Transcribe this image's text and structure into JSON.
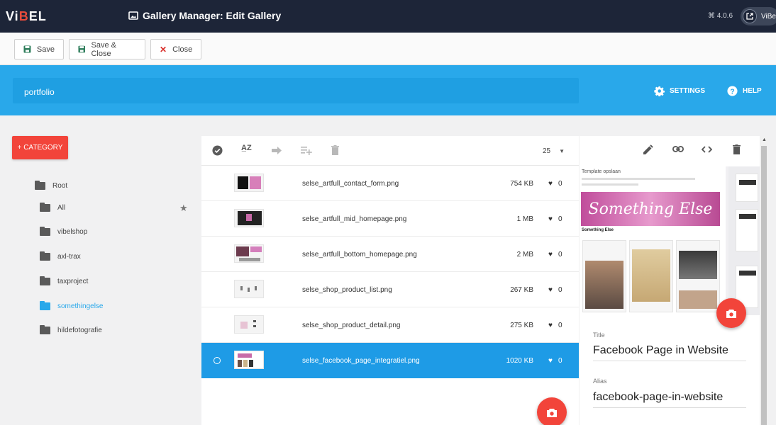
{
  "header": {
    "logo": {
      "part1": "Vi",
      "part2": "B",
      "part3": "EL"
    },
    "title": "Gallery Manager: Edit Gallery",
    "version": "⌘ 4.0.6",
    "user": "ViBel"
  },
  "toolbar": {
    "save_label": "Save",
    "save_close_label": "Save & Close",
    "close_label": "Close"
  },
  "gallery": {
    "name_value": "portfolio",
    "settings_label": "SETTINGS",
    "help_label": "HELP"
  },
  "sidebar": {
    "add_category_label": "+ CATEGORY",
    "items": [
      {
        "label": "Root"
      },
      {
        "label": "All"
      },
      {
        "label": "vibelshop"
      },
      {
        "label": "axl-trax"
      },
      {
        "label": "taxproject"
      },
      {
        "label": "somethingelse"
      },
      {
        "label": "hildefotografie"
      }
    ]
  },
  "list": {
    "per_page": "25",
    "rows": [
      {
        "name": "selse_artfull_contact_form.png",
        "size": "754 KB",
        "likes": "0"
      },
      {
        "name": "selse_artfull_mid_homepage.png",
        "size": "1 MB",
        "likes": "0"
      },
      {
        "name": "selse_artfull_bottom_homepage.png",
        "size": "2 MB",
        "likes": "0"
      },
      {
        "name": "selse_shop_product_list.png",
        "size": "267 KB",
        "likes": "0"
      },
      {
        "name": "selse_shop_product_detail.png",
        "size": "275 KB",
        "likes": "0"
      },
      {
        "name": "selse_facebook_page_integratiel.png",
        "size": "1020 KB",
        "likes": "0"
      }
    ]
  },
  "detail": {
    "title_label": "Title",
    "title_value": "Facebook Page in Website",
    "alias_label": "Alias",
    "alias_value": "facebook-page-in-website",
    "preview": {
      "top_text": "Something Else",
      "banner_text": "Something Else",
      "heading": "Template opslaan",
      "page_name": "Something Else"
    }
  },
  "colors": {
    "accent_blue": "#29a8ea",
    "accent_red": "#f2443a",
    "header_bg": "#1d2538"
  }
}
